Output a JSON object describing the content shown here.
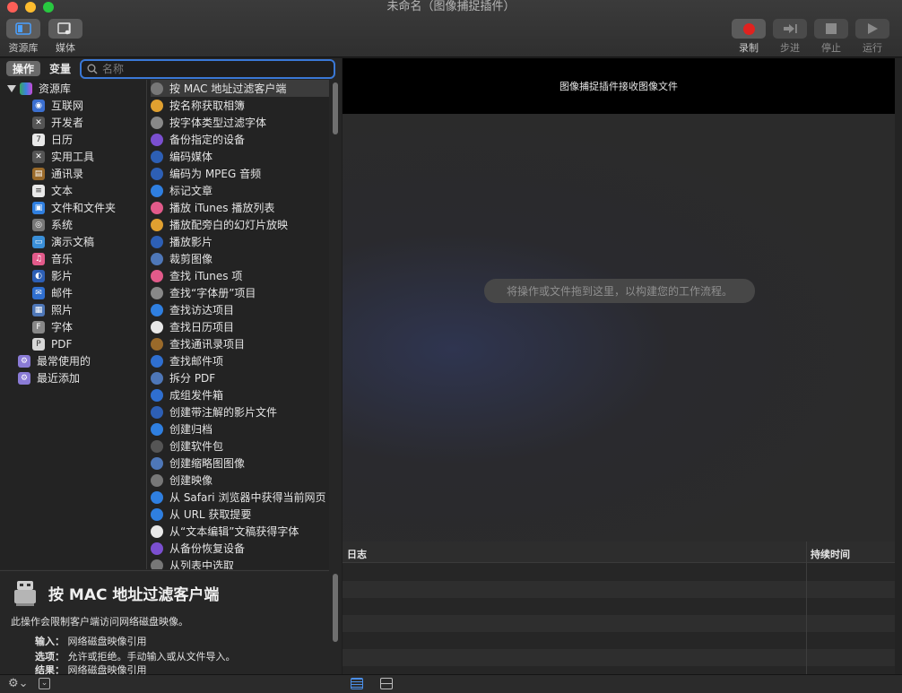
{
  "window": {
    "title": "未命名（图像捕捉插件）"
  },
  "toolbar": {
    "library_label": "资源库",
    "media_label": "媒体",
    "record_label": "录制",
    "step_label": "步进",
    "stop_label": "停止",
    "run_label": "运行"
  },
  "tabs": {
    "actions": "操作",
    "variables": "变量"
  },
  "search": {
    "placeholder": "名称",
    "value": ""
  },
  "library": {
    "root": "资源库",
    "categories": [
      "互联网",
      "开发者",
      "日历",
      "实用工具",
      "通讯录",
      "文本",
      "文件和文件夹",
      "系统",
      "演示文稿",
      "音乐",
      "影片",
      "邮件",
      "照片",
      "字体",
      "PDF"
    ],
    "smart": [
      "最常使用的",
      "最近添加"
    ]
  },
  "actions": [
    "按 MAC 地址过滤客户端",
    "按名称获取相簿",
    "按字体类型过滤字体",
    "备份指定的设备",
    "编码媒体",
    "编码为 MPEG 音频",
    "标记文章",
    "播放 iTunes 播放列表",
    "播放配旁白的幻灯片放映",
    "播放影片",
    "裁剪图像",
    "查找 iTunes 项",
    "查找“字体册”项目",
    "查找访达项目",
    "查找日历项目",
    "查找通讯录项目",
    "查找邮件项",
    "拆分 PDF",
    "成组发件箱",
    "创建带注解的影片文件",
    "创建归档",
    "创建软件包",
    "创建缩略图图像",
    "创建映像",
    "从 Safari 浏览器中获得当前网页",
    "从 URL 获取提要",
    "从“文本编辑”文稿获得字体",
    "从备份恢复设备",
    "从列表中选取"
  ],
  "description": {
    "title": "按 MAC 地址过滤客户端",
    "summary": "此操作会限制客户端访问网络磁盘映像。",
    "input_label": "输入：",
    "input_value": "网络磁盘映像引用",
    "options_label": "选项：",
    "options_value": "允许或拒绝。手动输入或从文件导入。",
    "result_label": "结果：",
    "result_value": "网络磁盘映像引用"
  },
  "workflow": {
    "header": "图像捕捉插件接收图像文件",
    "hint": "将操作或文件拖到这里，以构建您的工作流程。"
  },
  "log": {
    "col_log": "日志",
    "col_duration": "持续时间"
  },
  "colors": {
    "accent": "#3a78d6",
    "record": "#e0221f"
  }
}
